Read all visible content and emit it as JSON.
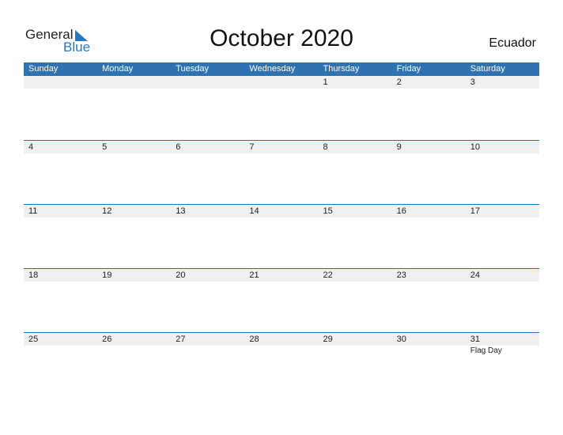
{
  "logo": {
    "general": "General",
    "blue": "Blue"
  },
  "title": "October 2020",
  "country": "Ecuador",
  "colors": {
    "header": "#2e72b2",
    "row_shade": "#f0f0f0",
    "brand_blue": "#2a78c4"
  },
  "weekdays": [
    "Sunday",
    "Monday",
    "Tuesday",
    "Wednesday",
    "Thursday",
    "Friday",
    "Saturday"
  ],
  "weeks": [
    {
      "dates": [
        "",
        "",
        "",
        "",
        "1",
        "2",
        "3"
      ],
      "events": [
        "",
        "",
        "",
        "",
        "",
        "",
        ""
      ]
    },
    {
      "dates": [
        "4",
        "5",
        "6",
        "7",
        "8",
        "9",
        "10"
      ],
      "events": [
        "",
        "",
        "",
        "",
        "",
        "",
        ""
      ]
    },
    {
      "dates": [
        "11",
        "12",
        "13",
        "14",
        "15",
        "16",
        "17"
      ],
      "events": [
        "",
        "",
        "",
        "",
        "",
        "",
        ""
      ]
    },
    {
      "dates": [
        "18",
        "19",
        "20",
        "21",
        "22",
        "23",
        "24"
      ],
      "events": [
        "",
        "",
        "",
        "",
        "",
        "",
        ""
      ]
    },
    {
      "dates": [
        "25",
        "26",
        "27",
        "28",
        "29",
        "30",
        "31"
      ],
      "events": [
        "",
        "",
        "",
        "",
        "",
        "",
        "Flag Day"
      ]
    }
  ]
}
